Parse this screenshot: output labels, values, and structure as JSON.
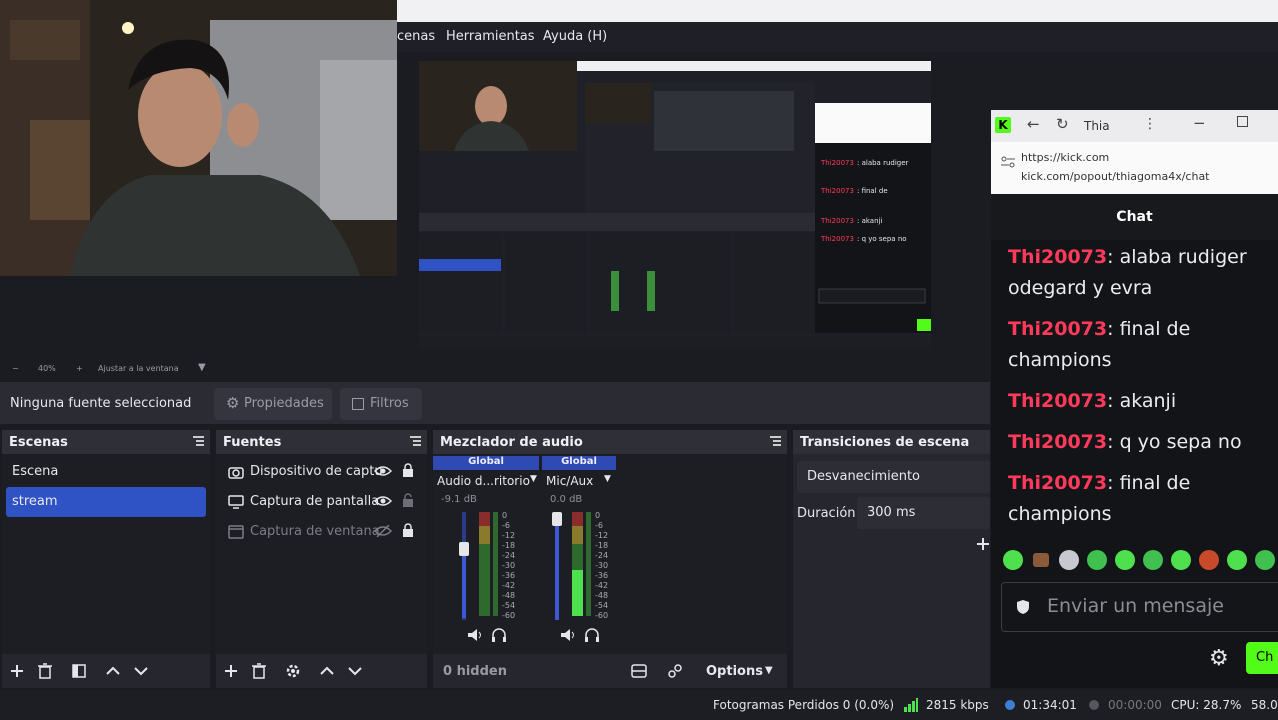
{
  "menu": {
    "escenas": "cenas",
    "herramientas": "Herramientas",
    "ayuda": "Ayuda (H)"
  },
  "zoom": {
    "minus": "−",
    "value": "40%",
    "plus": "+",
    "fit": "Ajustar a la ventana"
  },
  "source_bar": {
    "no_source": "Ninguna fuente seleccionad",
    "properties": "Propiedades",
    "filters": "Filtros"
  },
  "scenes": {
    "title": "Escenas",
    "items": [
      "Escena",
      "stream"
    ],
    "selected": 1
  },
  "sources": {
    "title": "Fuentes",
    "items": [
      {
        "label": "Dispositivo de captu",
        "visible": true
      },
      {
        "label": "Captura de pantalla",
        "visible": true
      },
      {
        "label": "Captura de ventana",
        "visible": false
      }
    ]
  },
  "mixer": {
    "title": "Mezclador de audio",
    "channels": [
      {
        "group": "Global",
        "name": "Audio d...ritorio",
        "db": "-9.1 dB",
        "fader_level": 0.6
      },
      {
        "group": "Global",
        "name": "Mic/Aux",
        "db": "0.0 dB",
        "fader_level": 0.95
      }
    ],
    "scale": [
      "0",
      "-6",
      "-12",
      "-18",
      "-24",
      "-30",
      "-36",
      "-42",
      "-48",
      "-54",
      "-60"
    ],
    "hidden": "0 hidden",
    "options": "Options"
  },
  "transitions": {
    "title": "Transiciones de escena",
    "transition": "Desvanecimiento",
    "duration_label": "Duración",
    "duration": "300 ms"
  },
  "status": {
    "dropped": "Fotogramas Perdidos 0 (0.0%)",
    "bitrate": "2815 kbps",
    "stream_time": "01:34:01",
    "rec_time": "00:00:00",
    "cpu": "CPU: 28.7%",
    "fps": "58.0"
  },
  "chat": {
    "tab_title": "Thia",
    "url_host": "https://kick.com",
    "url_path": "kick.com/popout/thiagoma4x/chat",
    "heading": "Chat",
    "messages": [
      {
        "user": "Thi20073",
        "text": "alaba rudiger odegard y evra"
      },
      {
        "user": "Thi20073",
        "text": "final de champions"
      },
      {
        "user": "Thi20073",
        "text": "akanji"
      },
      {
        "user": "Thi20073",
        "text": "q yo sepa no"
      },
      {
        "user": "Thi20073",
        "text": "final de champions"
      }
    ],
    "input_placeholder": "Enviar un mensaje",
    "send": "Ch"
  },
  "colors": {
    "accent_blue": "#2f52c4",
    "kick_green": "#53fc18",
    "username": "#ff3a5a"
  }
}
